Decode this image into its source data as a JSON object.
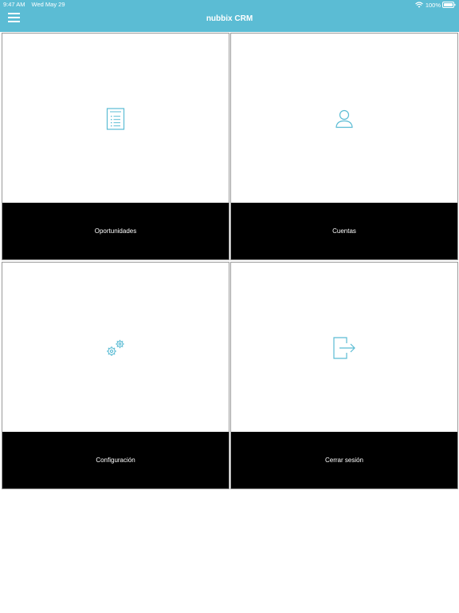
{
  "status_bar": {
    "time": "9:47 AM",
    "date": "Wed May 29",
    "battery": "100%"
  },
  "header": {
    "title": "nubbix CRM",
    "menu_icon": "hamburger-menu-icon"
  },
  "tiles": [
    {
      "label": "Oportunidades",
      "icon": "document-list-icon"
    },
    {
      "label": "Cuentas",
      "icon": "user-icon"
    },
    {
      "label": "Configuración",
      "icon": "gears-icon"
    },
    {
      "label": "Cerrar sesión",
      "icon": "logout-icon"
    }
  ],
  "colors": {
    "accent": "#5bbcd4",
    "label_bg": "#000000"
  }
}
